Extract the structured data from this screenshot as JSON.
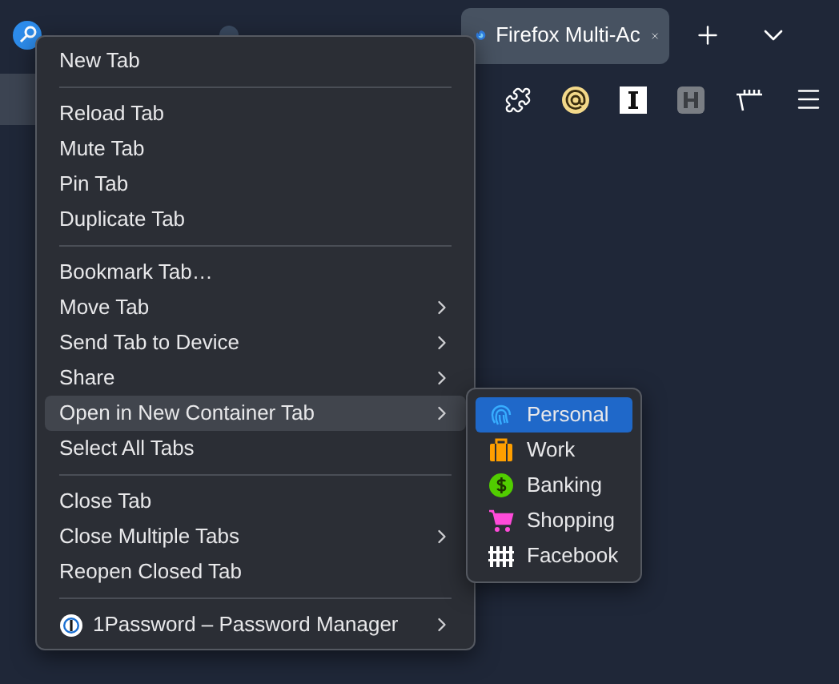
{
  "active_tab": {
    "title": "Firefox Multi-Ac"
  },
  "menu": {
    "items": [
      {
        "kind": "item",
        "label": "New Tab",
        "submenu": false,
        "selected": false
      },
      {
        "kind": "separator"
      },
      {
        "kind": "item",
        "label": "Reload Tab",
        "submenu": false,
        "selected": false
      },
      {
        "kind": "item",
        "label": "Mute Tab",
        "submenu": false,
        "selected": false
      },
      {
        "kind": "item",
        "label": "Pin Tab",
        "submenu": false,
        "selected": false
      },
      {
        "kind": "item",
        "label": "Duplicate Tab",
        "submenu": false,
        "selected": false
      },
      {
        "kind": "separator"
      },
      {
        "kind": "item",
        "label": "Bookmark Tab…",
        "submenu": false,
        "selected": false
      },
      {
        "kind": "item",
        "label": "Move Tab",
        "submenu": true,
        "selected": false
      },
      {
        "kind": "item",
        "label": "Send Tab to Device",
        "submenu": true,
        "selected": false
      },
      {
        "kind": "item",
        "label": "Share",
        "submenu": true,
        "selected": false
      },
      {
        "kind": "item",
        "label": "Open in New Container Tab",
        "submenu": true,
        "selected": true
      },
      {
        "kind": "item",
        "label": "Select All Tabs",
        "submenu": false,
        "selected": false
      },
      {
        "kind": "separator"
      },
      {
        "kind": "item",
        "label": "Close Tab",
        "submenu": false,
        "selected": false
      },
      {
        "kind": "item",
        "label": "Close Multiple Tabs",
        "submenu": true,
        "selected": false
      },
      {
        "kind": "item",
        "label": "Reopen Closed Tab",
        "submenu": false,
        "selected": false
      },
      {
        "kind": "separator"
      },
      {
        "kind": "extension",
        "label": "1Password – Password Manager",
        "submenu": true,
        "selected": false
      }
    ]
  },
  "container_menu": {
    "items": [
      {
        "kind": "fingerprint",
        "label": "Personal",
        "color": "#37adff",
        "selected": true
      },
      {
        "kind": "briefcase",
        "label": "Work",
        "color": "#ff9f00",
        "selected": false
      },
      {
        "kind": "dollar",
        "label": "Banking",
        "color": "#51cd00",
        "selected": false
      },
      {
        "kind": "cart",
        "label": "Shopping",
        "color": "#ff4bda",
        "selected": false
      },
      {
        "kind": "fence",
        "label": "Facebook",
        "color": "#ffffff",
        "selected": false
      }
    ]
  }
}
